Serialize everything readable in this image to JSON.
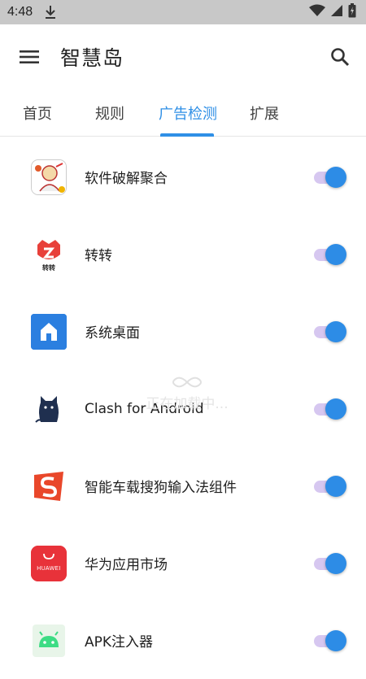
{
  "status_bar": {
    "time": "4:48",
    "icons": [
      "download-icon",
      "wifi-icon",
      "signal-icon",
      "battery-icon"
    ]
  },
  "app_bar": {
    "title": "智慧岛",
    "menu_icon": "menu-icon",
    "search_icon": "search-icon"
  },
  "tabs": [
    {
      "label": "首页"
    },
    {
      "label": "规则"
    },
    {
      "label": "广告检测",
      "active": true
    },
    {
      "label": "扩展"
    }
  ],
  "colors": {
    "accent": "#2f8fe6",
    "switch_track": "#d6c7f0",
    "switch_thumb": "#2d8ce6"
  },
  "apps": [
    {
      "name": "软件破解聚合",
      "icon": "cracked-apps-icon",
      "enabled": true
    },
    {
      "name": "转转",
      "icon": "zhuanzhuan-icon",
      "enabled": true
    },
    {
      "name": "系统桌面",
      "icon": "home-launcher-icon",
      "enabled": true
    },
    {
      "name": "Clash for Android",
      "icon": "clash-cat-icon",
      "enabled": true
    },
    {
      "name": "智能车载搜狗输入法组件",
      "icon": "sogou-input-icon",
      "enabled": true
    },
    {
      "name": "华为应用市场",
      "icon": "huawei-appgallery-icon",
      "icon_text": "HUAWEI",
      "enabled": true
    },
    {
      "name": "APK注入器",
      "icon": "android-apk-icon",
      "enabled": true
    }
  ],
  "loading": {
    "text": "正在加载中..."
  }
}
